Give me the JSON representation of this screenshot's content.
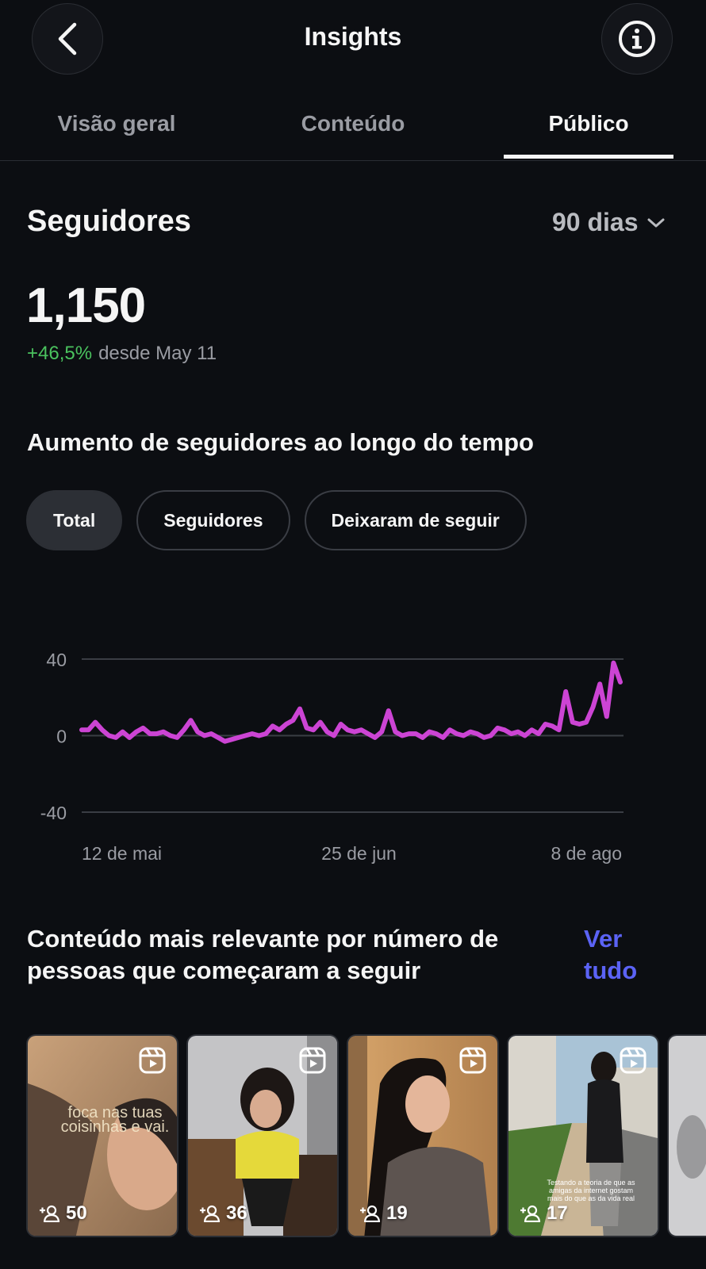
{
  "header": {
    "title": "Insights"
  },
  "tabs": [
    {
      "label": "Visão geral",
      "active": false
    },
    {
      "label": "Conteúdo",
      "active": false
    },
    {
      "label": "Público",
      "active": true
    }
  ],
  "followers": {
    "section_title": "Seguidores",
    "period": "90 dias",
    "total": "1,150",
    "change_pct": "+46,5%",
    "change_since": "desde May 11"
  },
  "growth": {
    "title": "Aumento de seguidores ao longo do tempo",
    "chips": [
      {
        "label": "Total",
        "active": true
      },
      {
        "label": "Seguidores",
        "active": false
      },
      {
        "label": "Deixaram de seguir",
        "active": false
      }
    ]
  },
  "chart_data": {
    "type": "line",
    "color": "#cc44d4",
    "ylim": [
      -40,
      40
    ],
    "yticks": [
      "40",
      "0",
      "-40"
    ],
    "xticks": [
      "12 de mai",
      "25 de jun",
      "8 de ago"
    ],
    "grid": true,
    "series": [
      {
        "values": [
          3,
          3,
          7,
          3,
          0,
          -1,
          2,
          -1,
          2,
          4,
          1,
          1,
          2,
          0,
          -1,
          3,
          8,
          2,
          0,
          1,
          -1,
          -3,
          -2,
          -1,
          0,
          1,
          0,
          1,
          5,
          3,
          6,
          8,
          14,
          4,
          3,
          7,
          2,
          0,
          6,
          3,
          2,
          3,
          1,
          -1,
          2,
          13,
          2,
          0,
          1,
          1,
          -1,
          2,
          1,
          -1,
          3,
          1,
          0,
          2,
          1,
          -1,
          0,
          4,
          3,
          1,
          2,
          0,
          3,
          1,
          6,
          5,
          3,
          23,
          7,
          6,
          7,
          15,
          27,
          10,
          38,
          28
        ]
      }
    ]
  },
  "relevant": {
    "title": "Conteúdo mais relevante por número de pessoas que começaram a seguir",
    "see_all": "Ver tudo",
    "items": [
      {
        "count": "50",
        "overlay": "foca nas tuas coisinhas e vai."
      },
      {
        "count": "36"
      },
      {
        "count": "19"
      },
      {
        "count": "17",
        "overlay": "Testando a teoria de que as amigas da internet gostam mais do que as da vida real"
      }
    ]
  }
}
